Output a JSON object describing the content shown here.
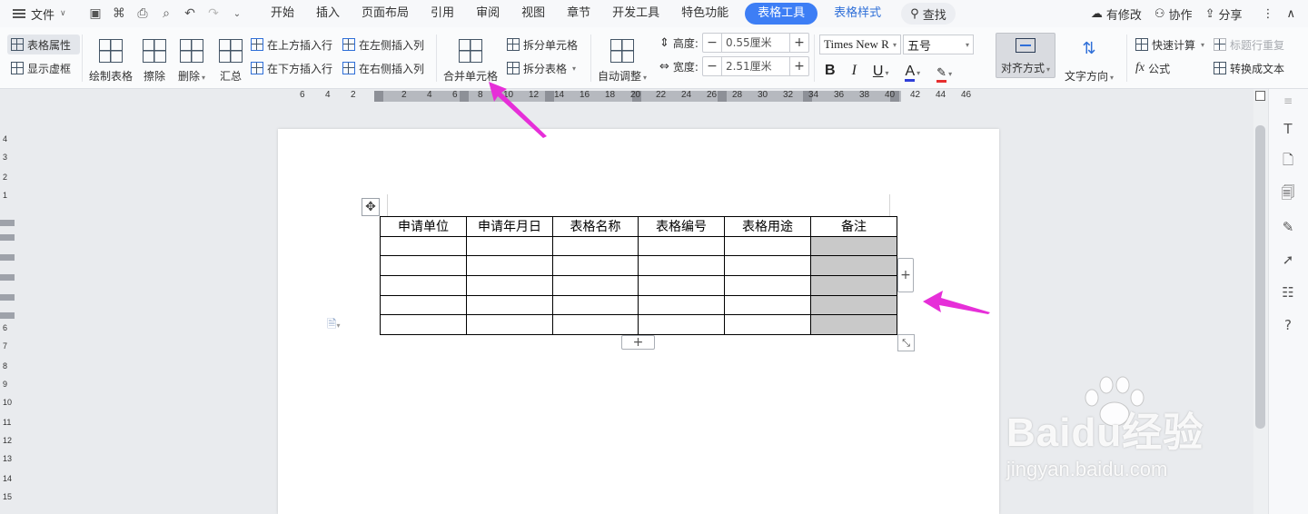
{
  "menubar": {
    "file_label": "文件",
    "tabs": [
      "开始",
      "插入",
      "页面布局",
      "引用",
      "审阅",
      "视图",
      "章节",
      "开发工具",
      "特色功能"
    ],
    "active_tab": "表格工具",
    "secondary_tab": "表格样式",
    "search_label": "查找",
    "right": {
      "modify": "有修改",
      "collab": "协作",
      "share": "分享"
    }
  },
  "ribbon": {
    "table_props": "表格属性",
    "show_grid": "显示虚框",
    "draw_table": "绘制表格",
    "erase": "擦除",
    "delete": "删除",
    "summary": "汇总",
    "insert_above": "在上方插入行",
    "insert_below": "在下方插入行",
    "insert_left": "在左侧插入列",
    "insert_right": "在右侧插入列",
    "merge_cells": "合并单元格",
    "split_cells": "拆分单元格",
    "split_table": "拆分表格",
    "auto_fit": "自动调整",
    "height_label": "高度:",
    "height_value": "0.55厘米",
    "width_label": "宽度:",
    "width_value": "2.51厘米",
    "font_name": "Times New R",
    "font_size": "五号",
    "bold": "B",
    "italic": "I",
    "underline": "U",
    "font_color_letter": "A",
    "align": "对齐方式",
    "text_dir": "文字方向",
    "quick_calc": "快速计算",
    "repeat_header": "标题行重复",
    "formula": "公式",
    "to_text": "转换成文本"
  },
  "ruler": {
    "h_ticks": [
      "6",
      "4",
      "2",
      "2",
      "4",
      "6",
      "8",
      "10",
      "12",
      "14",
      "16",
      "18",
      "20",
      "22",
      "24",
      "26",
      "28",
      "30",
      "32",
      "34",
      "36",
      "38",
      "40",
      "42",
      "44",
      "46"
    ],
    "v_ticks": [
      "4",
      "3",
      "2",
      "1",
      "6",
      "7",
      "8",
      "9",
      "10",
      "11",
      "12",
      "13",
      "14",
      "15"
    ]
  },
  "table": {
    "headers": [
      "申请单位",
      "申请年月日",
      "表格名称",
      "表格编号",
      "表格用途",
      "备注"
    ],
    "empty_rows": 5,
    "selected_column": 5
  },
  "watermark": {
    "brand": "Baidu经验",
    "url": "jingyan.baidu.com"
  },
  "colors": {
    "accent": "#3d7ef5",
    "arrow": "#e62fd8",
    "selection": "#c9c9c9",
    "font_color": "#2f3fd8",
    "highlight": "#e62f2f"
  }
}
